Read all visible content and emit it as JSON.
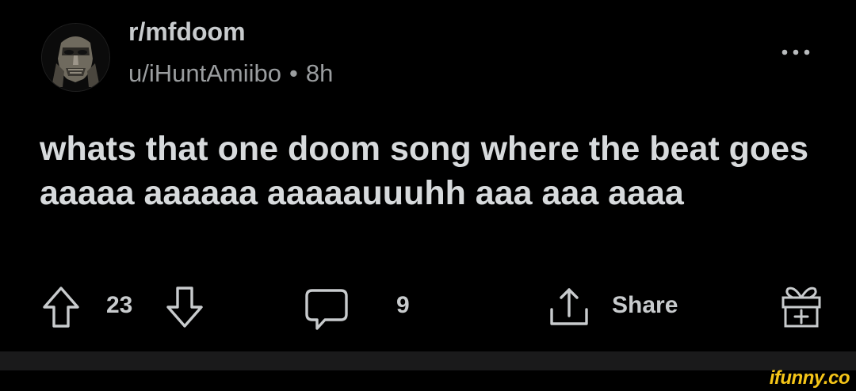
{
  "post": {
    "subreddit": "r/mfdoom",
    "author": "u/iHuntAmiibo",
    "separator": "•",
    "age": "8h",
    "title": "whats that one doom song where the beat goes aaaaa aaaaaa aaaaauuuhh aaa aaa aaaa"
  },
  "actions": {
    "upvote_icon": "arrow-up-outline-icon",
    "score": "23",
    "downvote_icon": "arrow-down-outline-icon",
    "comment_icon": "speech-bubble-icon",
    "comments": "9",
    "share_icon": "share-arrow-icon",
    "share_label": "Share",
    "award_icon": "gift-box-icon"
  },
  "header": {
    "more_icon": "ellipsis-icon",
    "avatar_icon": "mask-avatar-icon"
  },
  "watermark": "ifunny.co",
  "colors": {
    "background": "#000000",
    "text": "#d7dadc",
    "meta": "#9a9d9f",
    "watermark": "#f5c518"
  }
}
